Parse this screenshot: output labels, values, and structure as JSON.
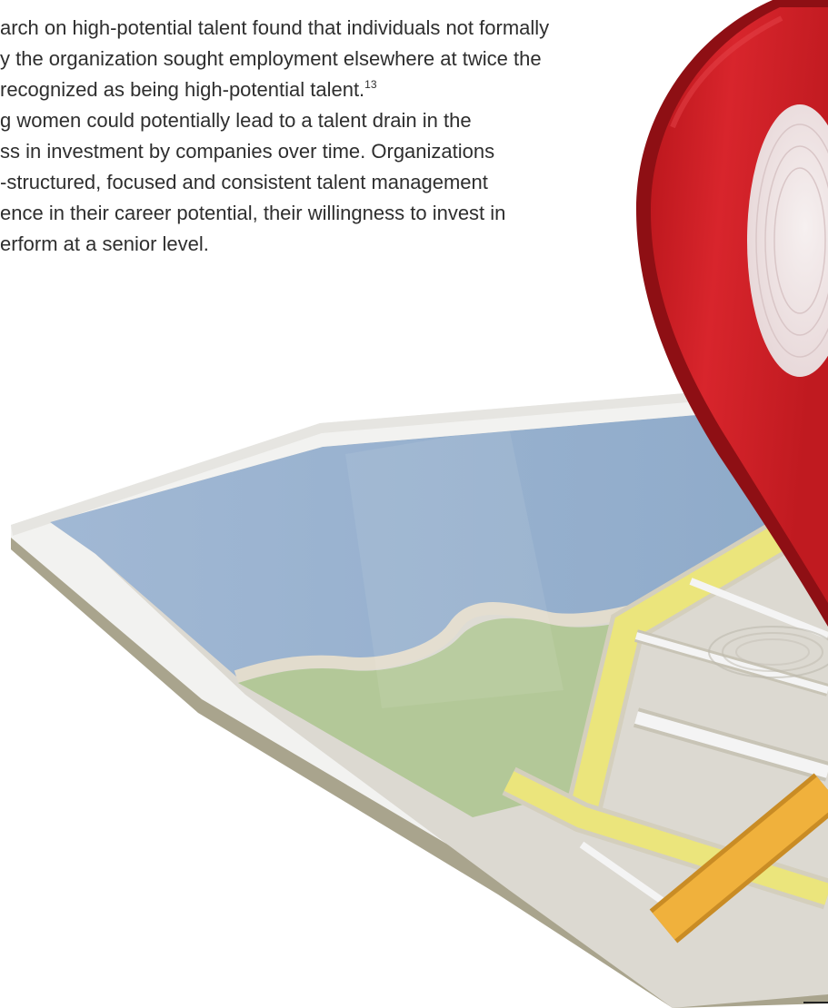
{
  "body_text": {
    "lines": [
      {
        "text": "arch on high-potential talent found that individuals not formally",
        "sup": ""
      },
      {
        "text": "y the organization sought employment elsewhere at twice the",
        "sup": ""
      },
      {
        "text": "recognized as being high-potential talent.",
        "sup": "13"
      },
      {
        "text": "g women could potentially lead to a talent drain in the",
        "sup": ""
      },
      {
        "text": "ss in investment by companies over time. Organizations",
        "sup": ""
      },
      {
        "text": "-structured, focused and consistent talent management",
        "sup": ""
      },
      {
        "text": "ence in their career potential, their willingness to invest in",
        "sup": ""
      },
      {
        "text": "erform at a senior level.",
        "sup": ""
      }
    ]
  },
  "illustration": {
    "subject": "folded-map-with-location-pin",
    "colors": {
      "water": "#9ab2cf",
      "park": "#b3c898",
      "road_yellow": "#ebe57c",
      "road_orange": "#f0b13c",
      "map_border": "#f2f2f0",
      "map_edge": "#a9a48d",
      "ground": "#dcd9d1",
      "pin_red": "#d62027",
      "pin_dark": "#8e0f14",
      "pin_face": "#f1e9e9"
    }
  }
}
